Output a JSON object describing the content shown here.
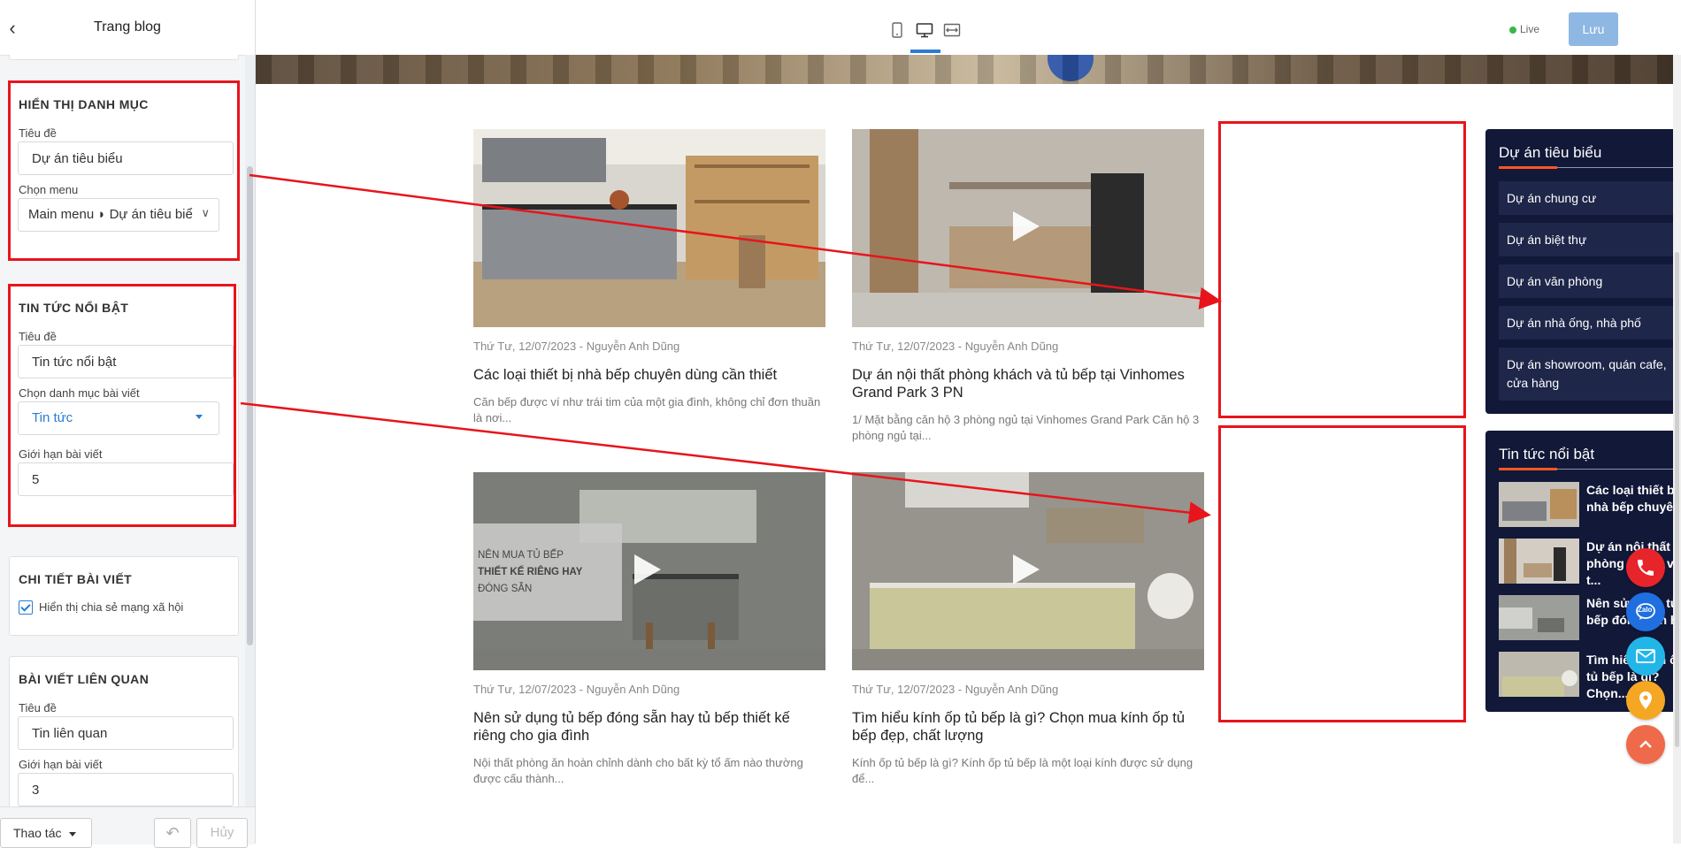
{
  "sidebar": {
    "title": "Trang blog",
    "sections": {
      "category": {
        "heading": "HIỂN THỊ DANH MỤC",
        "title_label": "Tiêu đề",
        "title_value": "Dự án tiêu biểu",
        "menu_label": "Chọn menu",
        "menu_value": "Main menu ◗ Dự án tiêu biểu"
      },
      "featured": {
        "heading": "TIN TỨC NỔI BẬT",
        "title_label": "Tiêu đề",
        "title_value": "Tin tức nổi bật",
        "category_label": "Chọn danh mục bài viết",
        "category_value": "Tin tức",
        "limit_label": "Giới hạn bài viết",
        "limit_value": "5"
      },
      "detail": {
        "heading": "CHI TIẾT BÀI VIẾT",
        "share_label": "Hiển thị chia sẻ mạng xã hội",
        "share_checked": true
      },
      "related": {
        "heading": "BÀI VIẾT LIÊN QUAN",
        "title_label": "Tiêu đề",
        "title_value": "Tin liên quan",
        "limit_label": "Giới hạn bài viết",
        "limit_value": "3"
      }
    },
    "footer": {
      "action_label": "Thao tác",
      "cancel_label": "Hủy"
    }
  },
  "toolbar": {
    "live_label": "Live",
    "save_label": "Lưu"
  },
  "posts": [
    {
      "meta": "Thứ Tư, 12/07/2023 - Nguyễn Anh Dũng",
      "title": "Các loại thiết bị nhà bếp chuyên dùng cần thiết",
      "excerpt": "Căn bếp được ví như trái tim của một gia đình, không chỉ đơn thuần là nơi...",
      "video": false
    },
    {
      "meta": "Thứ Tư, 12/07/2023 - Nguyễn Anh Dũng",
      "title": "Dự án nội thất phòng khách và tủ bếp tại Vinhomes Grand Park 3 PN",
      "excerpt": "1/ Mặt bằng căn hộ 3 phòng ngủ tại Vinhomes Grand Park Căn hộ 3 phòng ngủ tại...",
      "video": true
    },
    {
      "meta": "Thứ Tư, 12/07/2023 - Nguyễn Anh Dũng",
      "title": "Nên sử dụng tủ bếp đóng sẵn hay tủ bếp thiết kế riêng cho gia đình",
      "excerpt": "Nội thất phòng ăn hoàn chỉnh dành cho bất kỳ tổ ấm nào thường được cấu thành...",
      "video": true,
      "overlay_lines": [
        "NÊN MUA TỦ BẾP",
        "THIẾT KẾ RIÊNG HAY",
        "ĐÓNG SẴN"
      ]
    },
    {
      "meta": "Thứ Tư, 12/07/2023 - Nguyễn Anh Dũng",
      "title": "Tìm hiểu kính ốp tủ bếp là gì? Chọn mua kính ốp tủ bếp đẹp, chất lượng",
      "excerpt": "Kính ốp tủ bếp là gì? Kính ốp tủ bếp là một loại kính được sử dụng để...",
      "video": true
    }
  ],
  "widgets": {
    "projects": {
      "title": "Dự án tiêu biểu",
      "items": [
        "Dự án chung cư",
        "Dự án biệt thự",
        "Dự án văn phòng",
        "Dự án nhà ống, nhà phố",
        "Dự án showroom, quán cafe, cửa hàng"
      ]
    },
    "news": {
      "title": "Tin tức nổi bật",
      "items": [
        "Các loại thiết bị nhà bếp chuyên...",
        "Dự án nội thất phòng khách và t...",
        "Nên sử dụng tủ bếp đóng sẵn ha...",
        "Tìm hiểu kính ốp tủ bếp là gì? Chọn..."
      ]
    }
  },
  "floating_buttons": [
    {
      "icon": "phone-icon",
      "color": "#e8242b"
    },
    {
      "icon": "zalo-icon",
      "color": "#1f6fe0",
      "label": "Zalo"
    },
    {
      "icon": "mail-icon",
      "color": "#22b6e8"
    },
    {
      "icon": "location-pin-icon",
      "color": "#f5a623"
    },
    {
      "icon": "chevron-up-icon",
      "color": "#ef6a4a"
    }
  ],
  "colors": {
    "accent": "#2b7cd3",
    "widget_bg": "#111838",
    "widget_underline": "#ff5722",
    "annotation_red": "#e8141b"
  }
}
